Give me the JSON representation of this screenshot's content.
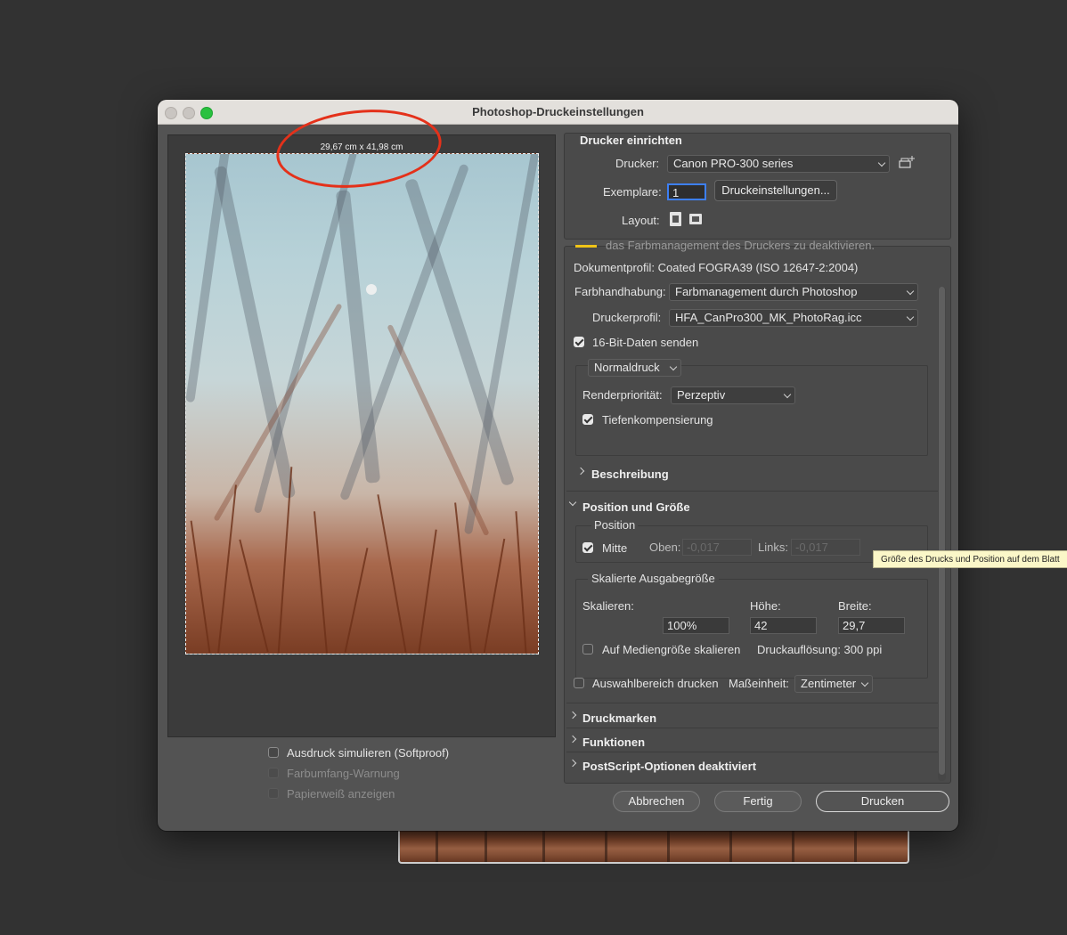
{
  "window": {
    "title": "Photoshop-Druckeinstellungen"
  },
  "preview": {
    "size_label": "29,67 cm x 41,98 cm",
    "options": [
      {
        "label": "Ausdruck simulieren (Softproof)",
        "checked": false,
        "enabled": true
      },
      {
        "label": "Farbumfang-Warnung",
        "checked": false,
        "enabled": false
      },
      {
        "label": "Papierweiß anzeigen",
        "checked": false,
        "enabled": false
      }
    ]
  },
  "printer_setup": {
    "heading": "Drucker einrichten",
    "printer_label": "Drucker:",
    "printer_value": "Canon PRO-300 series",
    "copies_label": "Exemplare:",
    "copies_value": "1",
    "print_settings_button": "Druckeinstellungen...",
    "layout_label": "Layout:",
    "layout_icons": [
      "portrait-layout-icon",
      "landscape-layout-icon"
    ]
  },
  "color": {
    "cut_text": "das Farbmanagement des Druckers zu deaktivieren.",
    "document_profile": "Dokumentprofil: Coated FOGRA39 (ISO 12647-2:2004)",
    "handling_label": "Farbhandhabung:",
    "handling_value": "Farbmanagement durch Photoshop",
    "printer_profile_label": "Druckerprofil:",
    "printer_profile_value": "HFA_CanPro300_MK_PhotoRag.icc",
    "sixteen_bit_label": "16-Bit-Daten senden",
    "sixteen_bit_checked": true,
    "proof_mode_value": "Normaldruck",
    "render_label": "Renderpriorität:",
    "render_value": "Perzeptiv",
    "blackpoint_label": "Tiefenkompensierung",
    "blackpoint_checked": true,
    "description_label": "Beschreibung"
  },
  "position_size": {
    "heading": "Position und Größe",
    "position_label": "Position",
    "center_label": "Mitte",
    "center_checked": true,
    "top_label": "Oben:",
    "top_value": "-0,017",
    "left_label": "Links:",
    "left_value": "-0,017",
    "scaled_label": "Skalierte Ausgabegröße",
    "scale_label": "Skalieren:",
    "scale_value": "100%",
    "height_label": "Höhe:",
    "height_value": "42",
    "width_label": "Breite:",
    "width_value": "29,7",
    "fit_media_label": "Auf Mediengröße skalieren",
    "fit_media_checked": false,
    "resolution_text": "Druckauflösung: 300 ppi",
    "selection_label": "Auswahlbereich drucken",
    "selection_checked": false,
    "unit_label": "Maßeinheit:",
    "unit_value": "Zentimeter"
  },
  "sections": [
    "Druckmarken",
    "Funktionen",
    "PostScript-Optionen deaktiviert"
  ],
  "buttons": {
    "cancel": "Abbrechen",
    "done": "Fertig",
    "print": "Drucken"
  },
  "tooltip": "Größe des Drucks und Position auf dem Blatt",
  "colors": {
    "annotation": "#e4311a",
    "tooltip_bg": "#fbf7c8",
    "window_bg": "#535353"
  }
}
